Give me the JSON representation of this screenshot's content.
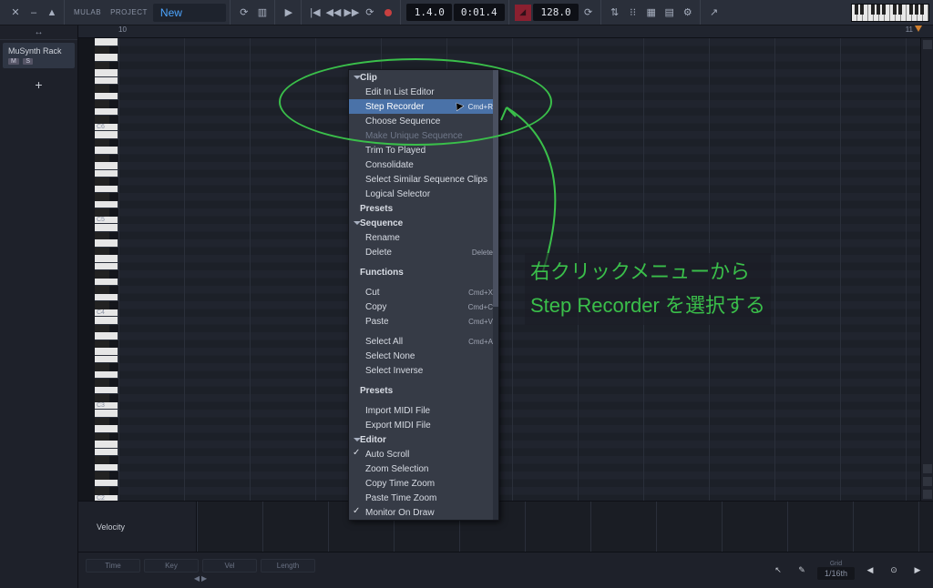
{
  "toolbar": {
    "app_label": "MULAB",
    "project_label": "PROJECT",
    "project_name": "New",
    "position_bar": "1.4.0",
    "position_time": "0:01.4",
    "tempo": "128.0",
    "transport": {
      "play": "▶",
      "to_start": "|◀",
      "rewind": "◀◀",
      "forward": "▶▶",
      "loop": "⟳"
    }
  },
  "tracks": {
    "header": "↔",
    "items": [
      {
        "name": "MuSynth Rack",
        "tags": [
          "M",
          "S"
        ]
      }
    ],
    "add_label": "+"
  },
  "ruler": {
    "bar10": "10",
    "bar11": "11"
  },
  "velocity_label": "Velocity",
  "footer": {
    "params": [
      "Time",
      "Key",
      "Vel",
      "Length"
    ],
    "grid_caption": "Grid",
    "grid_value": "1/16th"
  },
  "context_menu": {
    "sections": {
      "clip": "Clip",
      "sequence": "Sequence",
      "functions": "Functions",
      "presets": "Presets",
      "editor": "Editor"
    },
    "items": {
      "edit_in_list": "Edit In List Editor",
      "step_recorder": "Step Recorder",
      "step_recorder_sc": "Cmd+R",
      "choose_sequence": "Choose Sequence",
      "make_unique": "Make Unique Sequence",
      "trim_to_played": "Trim To Played",
      "consolidate": "Consolidate",
      "select_similar": "Select Similar Sequence Clips",
      "logical_selector": "Logical Selector",
      "rename": "Rename",
      "delete": "Delete",
      "delete_sc": "Delete",
      "cut": "Cut",
      "cut_sc": "Cmd+X",
      "copy": "Copy",
      "copy_sc": "Cmd+C",
      "paste": "Paste",
      "paste_sc": "Cmd+V",
      "select_all": "Select All",
      "select_all_sc": "Cmd+A",
      "select_none": "Select None",
      "select_inverse": "Select Inverse",
      "import_midi": "Import MIDI File",
      "export_midi": "Export MIDI File",
      "auto_scroll": "Auto Scroll",
      "zoom_selection": "Zoom Selection",
      "copy_time_zoom": "Copy Time Zoom",
      "paste_time_zoom": "Paste Time Zoom",
      "monitor_on_draw": "Monitor On Draw"
    }
  },
  "annotation": {
    "line1": "右クリックメニューから",
    "line2": "Step Recorder を選択する"
  },
  "octave_labels": [
    "C6",
    "C5",
    "C4",
    "C3",
    "C2"
  ]
}
